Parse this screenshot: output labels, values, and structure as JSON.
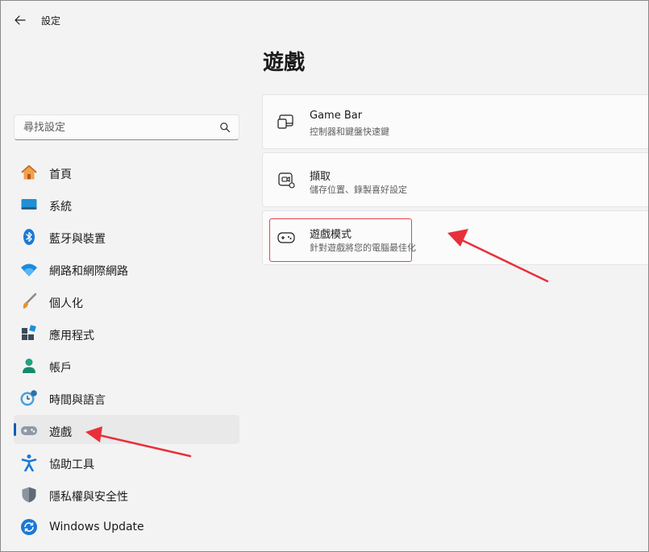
{
  "window": {
    "title": "設定"
  },
  "search": {
    "placeholder": "尋找設定"
  },
  "page": {
    "title": "遊戲"
  },
  "sidebar": {
    "items": [
      {
        "label": "首頁",
        "icon": "home-icon"
      },
      {
        "label": "系統",
        "icon": "system-icon"
      },
      {
        "label": "藍牙與裝置",
        "icon": "bluetooth-icon"
      },
      {
        "label": "網路和網際網路",
        "icon": "wifi-icon"
      },
      {
        "label": "個人化",
        "icon": "brush-icon"
      },
      {
        "label": "應用程式",
        "icon": "apps-icon"
      },
      {
        "label": "帳戶",
        "icon": "account-icon"
      },
      {
        "label": "時間與語言",
        "icon": "time-language-icon"
      },
      {
        "label": "遊戲",
        "icon": "gamepad-icon",
        "selected": true
      },
      {
        "label": "協助工具",
        "icon": "accessibility-icon"
      },
      {
        "label": "隱私權與安全性",
        "icon": "shield-icon"
      },
      {
        "label": "Windows Update",
        "icon": "update-icon"
      }
    ]
  },
  "cards": [
    {
      "title": "Game Bar",
      "subtitle": "控制器和鍵盤快速鍵",
      "icon": "game-bar-icon"
    },
    {
      "title": "擷取",
      "subtitle": "儲存位置、錄製喜好設定",
      "icon": "capture-icon"
    },
    {
      "title": "遊戲模式",
      "subtitle": "針對遊戲將您的電腦最佳化",
      "icon": "game-mode-icon"
    }
  ],
  "colors": {
    "accent": "#005fb8",
    "annotation": "#e8303a"
  }
}
